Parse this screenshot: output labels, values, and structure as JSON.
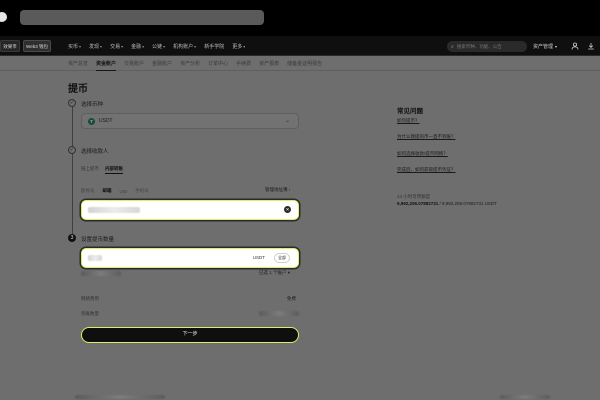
{
  "header": {
    "tags": [
      "效果币",
      "Web3 钱包"
    ],
    "nav": [
      {
        "label": "买币",
        "caret": true
      },
      {
        "label": "发现",
        "caret": true
      },
      {
        "label": "交易",
        "caret": true
      },
      {
        "label": "金融",
        "caret": true
      },
      {
        "label": "公链",
        "caret": true
      },
      {
        "label": "机构账户",
        "caret": true
      },
      {
        "label": "新手学院",
        "caret": false
      },
      {
        "label": "更多",
        "caret": true
      }
    ],
    "search_placeholder": "搜索币种、功能、公告",
    "asset_menu": "资产管理"
  },
  "sub_nav": [
    {
      "label": "资产总览",
      "active": false
    },
    {
      "label": "资金账户",
      "active": true
    },
    {
      "label": "交易账户",
      "active": false
    },
    {
      "label": "金融账户",
      "active": false
    },
    {
      "label": "资产分析",
      "active": false
    },
    {
      "label": "订单中心",
      "active": false
    },
    {
      "label": "手续费",
      "active": false
    },
    {
      "label": "资产报表",
      "active": false
    },
    {
      "label": "储备金证明报告",
      "active": false
    }
  ],
  "page_title": "提币",
  "steps": {
    "step1": {
      "marker": "✓",
      "label": "选择币种"
    },
    "step2": {
      "marker": "✓",
      "label": "选择收款人"
    },
    "step3": {
      "marker": "3",
      "label": "设置提币数量"
    }
  },
  "coin": {
    "icon": "T",
    "name": "USDT"
  },
  "recipient_tabs": [
    {
      "label": "链上提币",
      "active": false
    },
    {
      "label": "内部转账",
      "active": true
    }
  ],
  "methods": [
    {
      "label": "欧易号",
      "active": false
    },
    {
      "label": "邮箱",
      "active": true
    },
    {
      "label": "UID",
      "active": false
    },
    {
      "label": "手机号",
      "active": false
    }
  ],
  "manage_address": "管理地址簿 ›",
  "amount": {
    "unit": "USDT",
    "all_label": "全部"
  },
  "account_link": "已选 1 个账户 ▾",
  "info": {
    "fee_label": "网络费用",
    "fee_value": "免费",
    "receive_label": "到账数量"
  },
  "next_button": "下一步",
  "faq": {
    "title": "常见问题",
    "items": [
      "如何提币？",
      "为什么我提的币一直不到账？",
      "如何选择收款/提币网络？",
      "完成后，如何获取提币凭证？"
    ]
  },
  "limit": {
    "label": "24 小时可用额度",
    "used": "9,992,206.07882731",
    "total": " / 9,992,206.07882731 USDT"
  },
  "colors": {
    "accent": "#d7f266",
    "dark": "#0f0f0f",
    "overlay": "#6e6e6e"
  }
}
